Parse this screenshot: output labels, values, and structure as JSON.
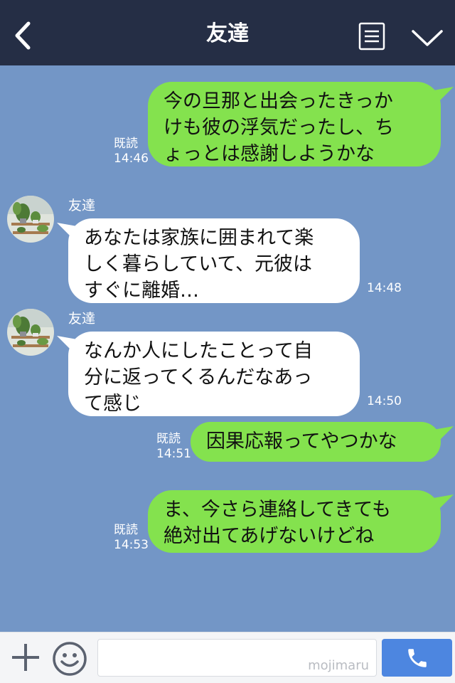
{
  "header": {
    "title": "友達",
    "back_icon": "chevron-left-icon",
    "menu_icon": "document-list-icon",
    "more_icon": "chevron-down-icon",
    "background": "#252e45"
  },
  "chat": {
    "background": "#7396c6",
    "sent_color": "#84e24e",
    "received_color": "#ffffff",
    "messages": [
      {
        "side": "sent",
        "lines": [
          "今の旦那と出会ったきっか",
          "けも彼の浮気だったし、ち",
          "ょっとは感謝しようかな"
        ],
        "read": "既読",
        "time": "14:46"
      },
      {
        "side": "received",
        "sender": "友達",
        "lines": [
          "あなたは家族に囲まれて楽",
          "しく暮らしていて、元彼は",
          "すぐに離婚…"
        ],
        "time": "14:48"
      },
      {
        "side": "received",
        "sender": "友達",
        "lines": [
          "なんか人にしたことって自",
          "分に返ってくるんだなあっ",
          "て感じ"
        ],
        "time": "14:50"
      },
      {
        "side": "sent",
        "lines": [
          "因果応報ってやつかな"
        ],
        "read": "既読",
        "time": "14:51"
      },
      {
        "side": "sent",
        "lines": [
          "ま、今さら連絡してきても",
          "絶対出てあげないけどね"
        ],
        "read": "既読",
        "time": "14:53"
      }
    ]
  },
  "footer": {
    "plus_icon": "plus-icon",
    "emoji_icon": "smiley-icon",
    "input_value": "",
    "watermark": "mojimaru",
    "call_icon": "phone-icon",
    "call_color": "#4d86e0"
  }
}
